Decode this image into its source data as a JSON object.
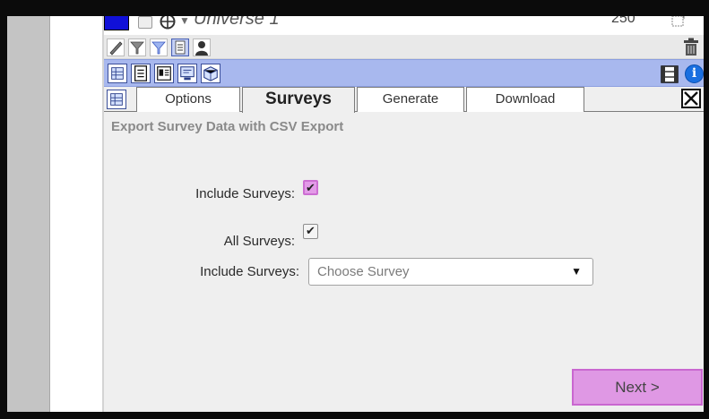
{
  "header": {
    "title": "Universe 1",
    "count": "250",
    "swatch_color": "#1010d8"
  },
  "tools": {
    "items": [
      "pencil-icon",
      "filter-icon",
      "filter-blue-icon",
      "list-icon",
      "person-icon"
    ],
    "trash": "trash-icon"
  },
  "blue_toolbar": {
    "items": [
      "table-icon",
      "document-icon",
      "card-icon",
      "screen-icon",
      "cube-icon"
    ],
    "film": "film-icon",
    "info_label": "i"
  },
  "tabs": [
    {
      "label": "Options",
      "active": false
    },
    {
      "label": "Surveys",
      "active": true
    },
    {
      "label": "Generate",
      "active": false
    },
    {
      "label": "Download",
      "active": false
    }
  ],
  "content": {
    "heading": "Export Survey Data with CSV Export",
    "include_surveys_label": "Include Surveys:",
    "include_surveys_checked": true,
    "all_surveys_label": "All Surveys:",
    "all_surveys_checked": true,
    "select_label": "Include Surveys:",
    "select_value": "Choose Survey"
  },
  "next_button": "Next >",
  "colors": {
    "accent_pink": "#df98e4",
    "toolbar_blue": "#a8b8ee"
  }
}
